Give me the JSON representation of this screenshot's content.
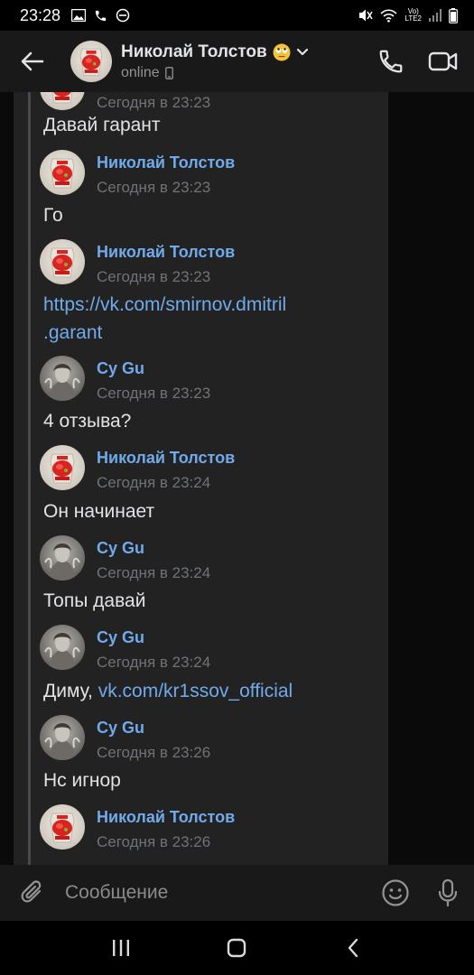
{
  "status_bar": {
    "time": "23:28",
    "network_top": "Vo)",
    "network_bottom": "LTE2"
  },
  "header": {
    "name": "Николай Толстов",
    "emoji": "rolling-eyes-face",
    "status": "online"
  },
  "messages": [
    {
      "author": "",
      "time": "Сегодня в 23:23",
      "text": "Давай гарант",
      "avatar": "ketchup",
      "partial": true
    },
    {
      "author": "Николай Толстов",
      "time": "Сегодня в 23:23",
      "text": "Го",
      "avatar": "ketchup"
    },
    {
      "author": "Николай Толстов",
      "time": "Сегодня в 23:23",
      "link_line1": "https://vk.com/smirnov.dmitril",
      "link_line2": ".garant",
      "avatar": "ketchup"
    },
    {
      "author": "Cy Gu",
      "time": "Сегодня в 23:23",
      "text": "4 отзыва?",
      "avatar": "gray"
    },
    {
      "author": "Николай Толстов",
      "time": "Сегодня в 23:24",
      "text": "Он начинает",
      "avatar": "ketchup"
    },
    {
      "author": "Cy Gu",
      "time": "Сегодня в 23:24",
      "text": "Топы давай",
      "avatar": "gray"
    },
    {
      "author": "Cy Gu",
      "time": "Сегодня в 23:24",
      "text_prefix": "Диму, ",
      "link": "vk.com/kr1ssov_official",
      "avatar": "gray"
    },
    {
      "author": "Cy Gu",
      "time": "Сегодня в 23:26",
      "text": "Нс игнор",
      "avatar": "gray"
    },
    {
      "author": "Николай Толстов",
      "time": "Сегодня в 23:26",
      "avatar": "ketchup"
    }
  ],
  "composer": {
    "placeholder": "Сообщение"
  },
  "colors": {
    "accent_link": "#71aaeb",
    "text": "#e1e3e6",
    "secondary": "#6f7379",
    "panel": "#222222",
    "header": "#191919"
  },
  "icons": [
    "back-arrow-icon",
    "phone-icon",
    "video-camera-icon",
    "paperclip-icon",
    "smile-icon",
    "microphone-icon",
    "recents-icon",
    "home-icon",
    "nav-back-icon"
  ]
}
